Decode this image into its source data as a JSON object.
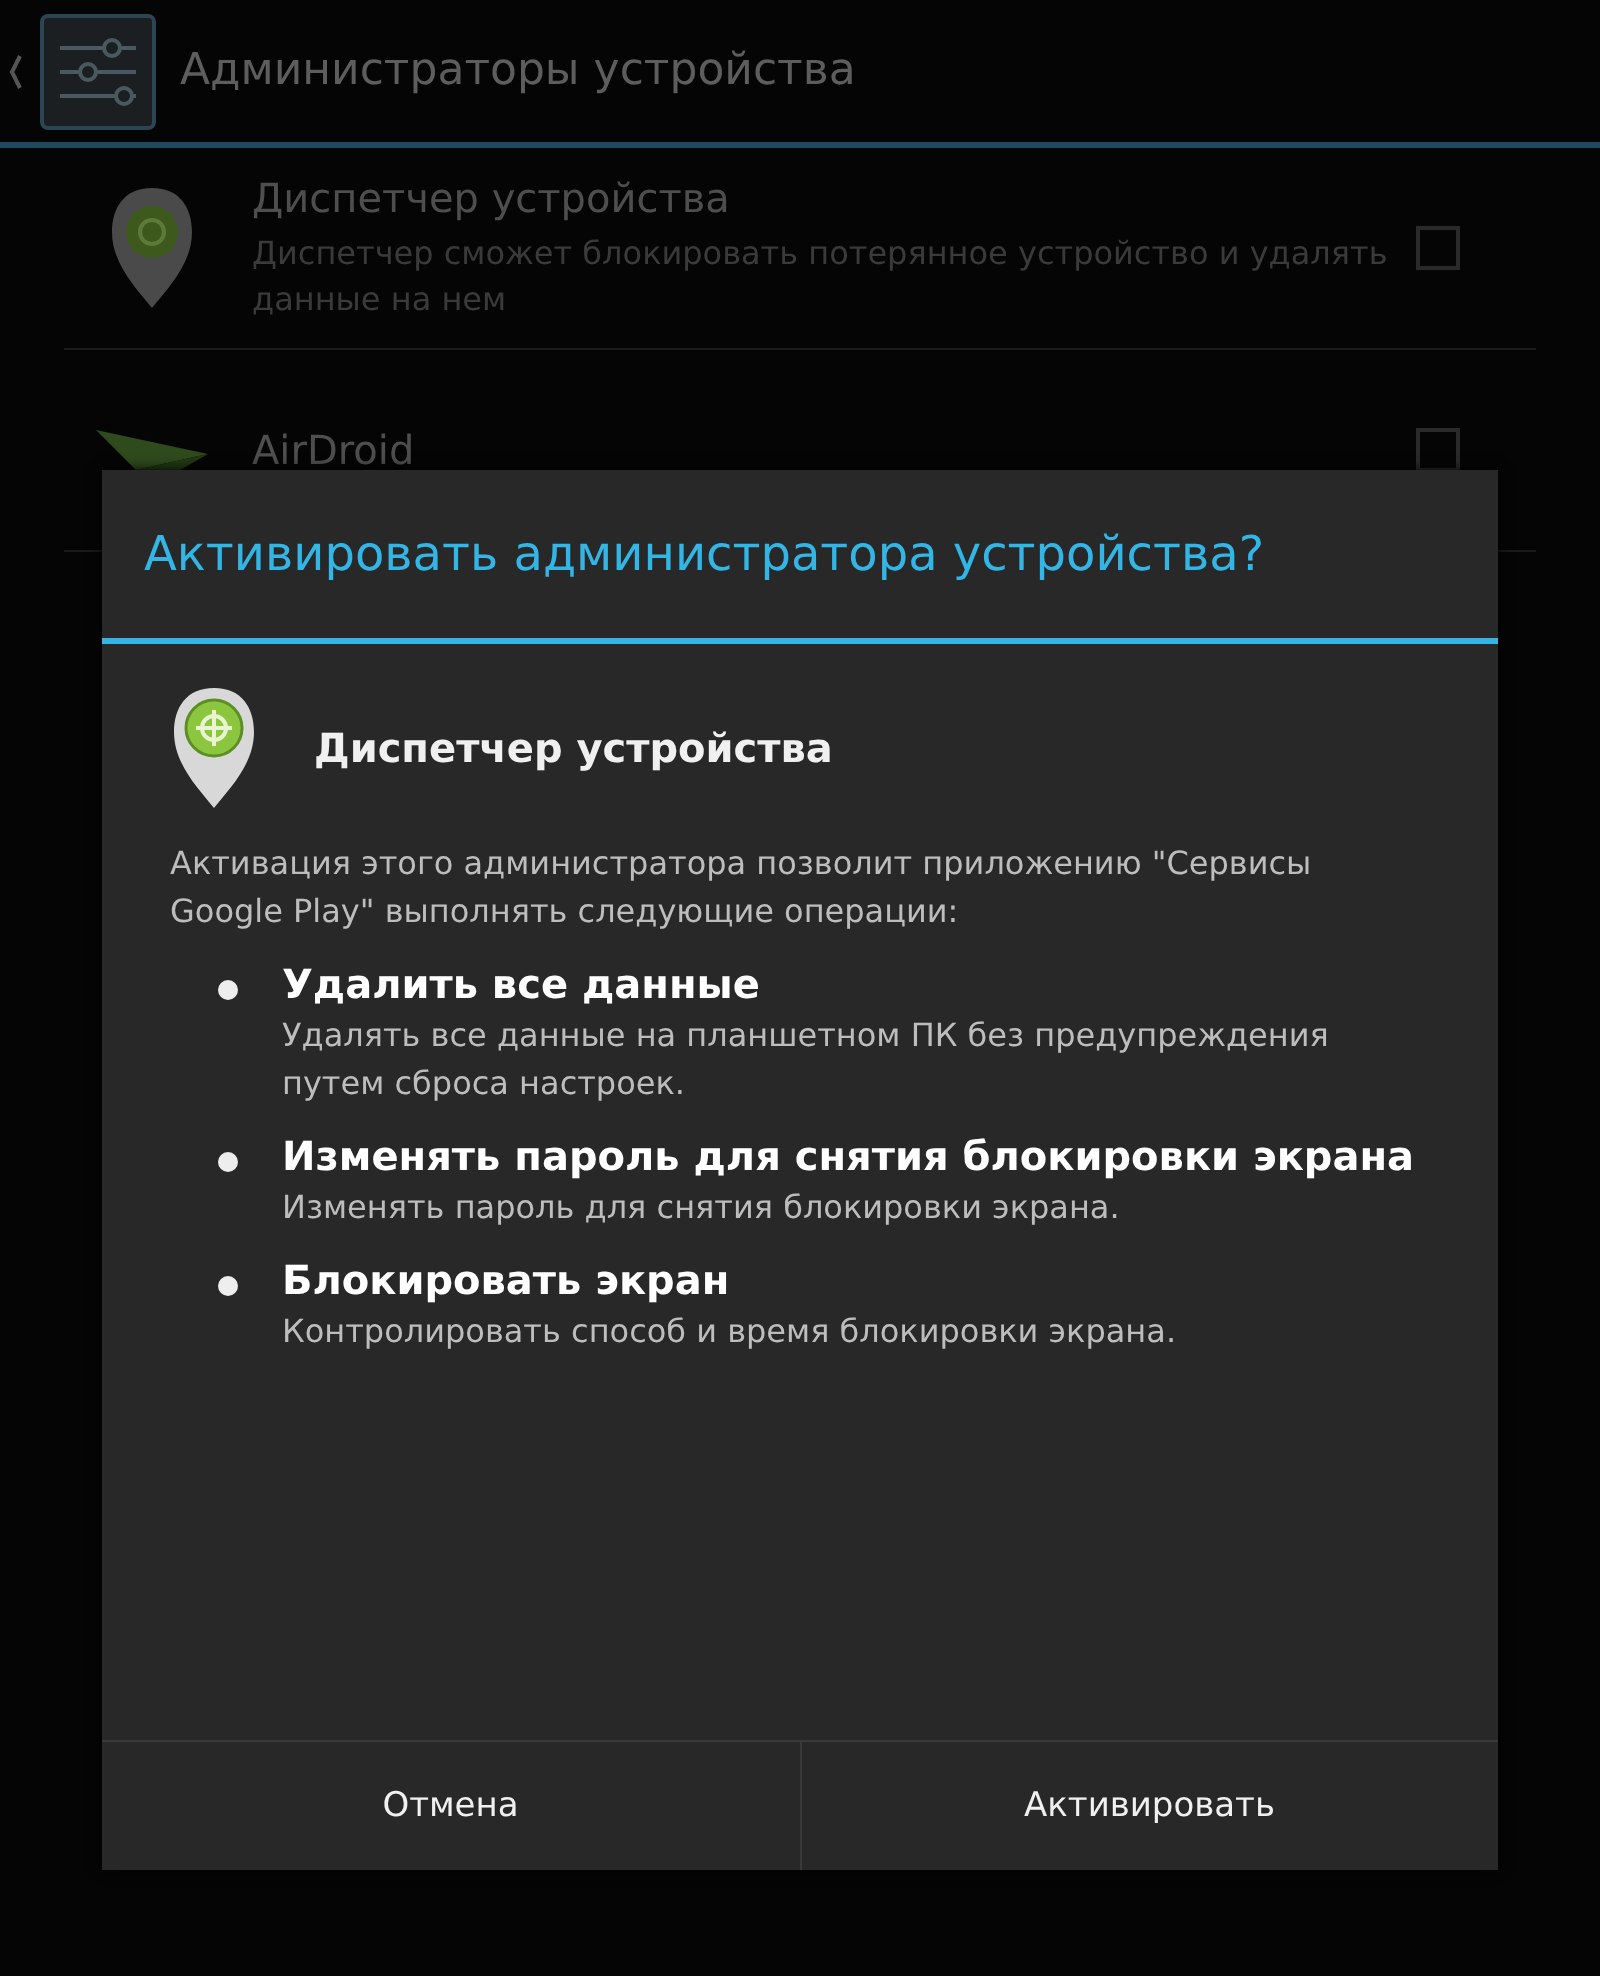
{
  "action_bar": {
    "title": "Администраторы устройства"
  },
  "admins": [
    {
      "kind": "locator",
      "name": "Диспетчер устройства",
      "description": "Диспетчер сможет блокировать потерянное устройство и удалять данные на нем",
      "checked": false
    },
    {
      "kind": "plane",
      "name": "AirDroid",
      "checked": false
    }
  ],
  "dialog": {
    "title": "Активировать администратора устройства?",
    "app_name": "Диспетчер устройства",
    "intro": "Активация этого администратора позволит приложению \"Сервисы Google Play\" выполнять следующие операции:",
    "policies": [
      {
        "title": "Удалить все данные",
        "description": "Удалять все данные на планшетном ПК без предупреждения путем сброса настроек."
      },
      {
        "title": "Изменять пароль для снятия блокировки экрана",
        "description": "Изменять пароль для снятия блокировки экрана."
      },
      {
        "title": "Блокировать экран",
        "description": "Контролировать способ и время блокировки экрана."
      }
    ],
    "buttons": [
      "Отмена",
      "Активировать"
    ]
  }
}
